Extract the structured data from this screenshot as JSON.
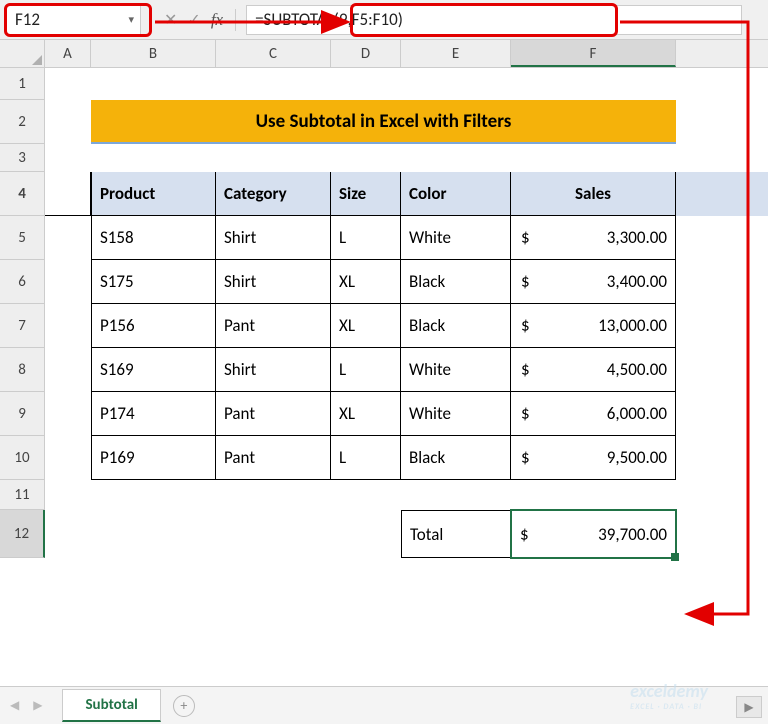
{
  "name_box_value": "F12",
  "formula_value": "=SUBTOTAL(9,F5:F10)",
  "columns": [
    "A",
    "B",
    "C",
    "D",
    "E",
    "F"
  ],
  "active_col": "F",
  "active_row": "12",
  "row_labels": [
    "1",
    "2",
    "3",
    "4",
    "5",
    "6",
    "7",
    "8",
    "9",
    "10",
    "11",
    "12"
  ],
  "title": "Use Subtotal in Excel with Filters",
  "headers": {
    "product": "Product",
    "category": "Category",
    "size": "Size",
    "color": "Color",
    "sales": "Sales"
  },
  "rows": [
    {
      "product": "S158",
      "category": "Shirt",
      "size": "L",
      "color": "White",
      "currency": "$",
      "sales": "3,300.00"
    },
    {
      "product": "S175",
      "category": "Shirt",
      "size": "XL",
      "color": "Black",
      "currency": "$",
      "sales": "3,400.00"
    },
    {
      "product": "P156",
      "category": "Pant",
      "size": "XL",
      "color": "Black",
      "currency": "$",
      "sales": "13,000.00"
    },
    {
      "product": "S169",
      "category": "Shirt",
      "size": "L",
      "color": "White",
      "currency": "$",
      "sales": "4,500.00"
    },
    {
      "product": "P174",
      "category": "Pant",
      "size": "XL",
      "color": "White",
      "currency": "$",
      "sales": "6,000.00"
    },
    {
      "product": "P169",
      "category": "Pant",
      "size": "L",
      "color": "Black",
      "currency": "$",
      "sales": "9,500.00"
    }
  ],
  "total_label": "Total",
  "total_currency": "$",
  "total_value": "39,700.00",
  "sheet_tab": "Subtotal",
  "watermark": "exceldemy",
  "watermark_sub": "EXCEL · DATA · BI",
  "fx_symbol": "fx",
  "chart_data": {
    "type": "table",
    "title": "Use Subtotal in Excel with Filters",
    "columns": [
      "Product",
      "Category",
      "Size",
      "Color",
      "Sales"
    ],
    "rows": [
      [
        "S158",
        "Shirt",
        "L",
        "White",
        3300.0
      ],
      [
        "S175",
        "Shirt",
        "XL",
        "Black",
        3400.0
      ],
      [
        "P156",
        "Pant",
        "XL",
        "Black",
        13000.0
      ],
      [
        "S169",
        "Shirt",
        "L",
        "White",
        4500.0
      ],
      [
        "P174",
        "Pant",
        "XL",
        "White",
        6000.0
      ],
      [
        "P169",
        "Pant",
        "L",
        "Black",
        9500.0
      ]
    ],
    "total": 39700.0,
    "formula": "=SUBTOTAL(9,F5:F10)"
  }
}
